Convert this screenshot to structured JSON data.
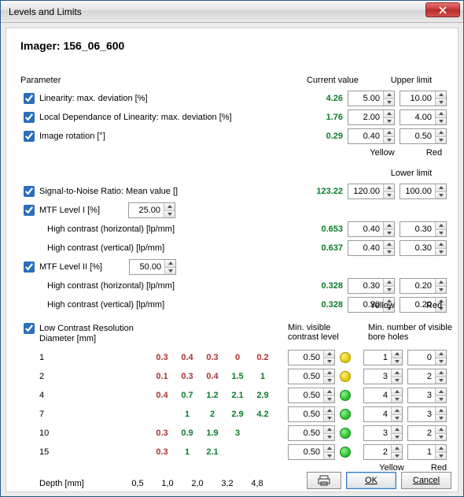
{
  "window": {
    "title": "Levels and Limits"
  },
  "imager": {
    "label": "Imager:",
    "id": "156_06_600"
  },
  "headers": {
    "parameter": "Parameter",
    "current": "Current value",
    "upper": "Upper limit",
    "lower": "Lower limit",
    "yellow": "Yellow",
    "red": "Red"
  },
  "upper_section": {
    "rows": [
      {
        "id": "linearity",
        "label": "Linearity: max. deviation [%]",
        "value": "4.26",
        "yellow": "5.00",
        "red": "10.00"
      },
      {
        "id": "local-dep",
        "label": "Local Dependance of Linearity: max. deviation [%]",
        "value": "1.76",
        "yellow": "2.00",
        "red": "4.00"
      },
      {
        "id": "rotation",
        "label": "Image rotation [°]",
        "value": "0.29",
        "yellow": "0.40",
        "red": "0.50"
      }
    ]
  },
  "lower_section": {
    "snr": {
      "label": "Signal-to-Noise Ratio: Mean value []",
      "value": "123.22",
      "yellow": "120.00",
      "red": "100.00"
    },
    "mtf1": {
      "label": "MTF Level I [%]",
      "level": "25.00",
      "rows": [
        {
          "id": "mtf1-h",
          "label": "High contrast (horizontal) [lp/mm]",
          "value": "0.653",
          "yellow": "0.40",
          "red": "0.30"
        },
        {
          "id": "mtf1-v",
          "label": "High contrast (vertical) [lp/mm]",
          "value": "0.637",
          "yellow": "0.40",
          "red": "0.30"
        }
      ]
    },
    "mtf2": {
      "label": "MTF Level II [%]",
      "level": "50.00",
      "rows": [
        {
          "id": "mtf2-h",
          "label": "High contrast (horizontal) [lp/mm]",
          "value": "0.328",
          "yellow": "0.30",
          "red": "0.20"
        },
        {
          "id": "mtf2-v",
          "label": "High contrast (vertical) [lp/mm]",
          "value": "0.328",
          "yellow": "0.30",
          "red": "0.20"
        }
      ]
    }
  },
  "lcr": {
    "label": "Low Contrast Resolution",
    "diameter_label": "Diameter [mm]",
    "depth_label": "Depth [mm]",
    "min_contrast_label": "Min. visible contrast level",
    "min_bore_label": "Min. number of visible bore holes",
    "depths": [
      "0,5",
      "1,0",
      "2,0",
      "3,2",
      "4,8"
    ],
    "rows": [
      {
        "d": "1",
        "cells": [
          {
            "v": "0.3",
            "c": "r05"
          },
          {
            "v": "0.4",
            "c": "r05"
          },
          {
            "v": "0.3",
            "c": "r05"
          },
          {
            "v": "0",
            "c": "r05"
          },
          {
            "v": "0.2",
            "c": "r05"
          }
        ],
        "min": "0.50",
        "dot": "yellow",
        "b1": "1",
        "b2": "0"
      },
      {
        "d": "2",
        "cells": [
          {
            "v": "0.1",
            "c": "r05"
          },
          {
            "v": "0.3",
            "c": "r05"
          },
          {
            "v": "0.4",
            "c": "r10"
          },
          {
            "v": "1.5",
            "c": "g"
          },
          {
            "v": "1",
            "c": "g"
          }
        ],
        "min": "0.50",
        "dot": "yellow",
        "b1": "3",
        "b2": "2"
      },
      {
        "d": "4",
        "cells": [
          {
            "v": "0.4",
            "c": "r05"
          },
          {
            "v": "0.7",
            "c": "g"
          },
          {
            "v": "1.2",
            "c": "g"
          },
          {
            "v": "2.1",
            "c": "g"
          },
          {
            "v": "2.9",
            "c": "g"
          }
        ],
        "min": "0.50",
        "dot": "green",
        "b1": "4",
        "b2": "3"
      },
      {
        "d": "7",
        "cells": [
          {
            "v": "",
            "c": ""
          },
          {
            "v": "1",
            "c": "g"
          },
          {
            "v": "2",
            "c": "g"
          },
          {
            "v": "2.9",
            "c": "g"
          },
          {
            "v": "4.2",
            "c": "g"
          }
        ],
        "min": "0.50",
        "dot": "green",
        "b1": "4",
        "b2": "3"
      },
      {
        "d": "10",
        "cells": [
          {
            "v": "0.3",
            "c": "r05"
          },
          {
            "v": "0.9",
            "c": "g"
          },
          {
            "v": "1.9",
            "c": "g"
          },
          {
            "v": "3",
            "c": "g"
          },
          {
            "v": "",
            "c": ""
          }
        ],
        "min": "0.50",
        "dot": "green",
        "b1": "3",
        "b2": "2"
      },
      {
        "d": "15",
        "cells": [
          {
            "v": "0.3",
            "c": "r05"
          },
          {
            "v": "1",
            "c": "g"
          },
          {
            "v": "2.1",
            "c": "g"
          },
          {
            "v": "",
            "c": ""
          },
          {
            "v": "",
            "c": ""
          }
        ],
        "min": "0.50",
        "dot": "green",
        "b1": "2",
        "b2": "1"
      }
    ]
  },
  "buttons": {
    "ok": "OK",
    "cancel": "Cancel"
  }
}
